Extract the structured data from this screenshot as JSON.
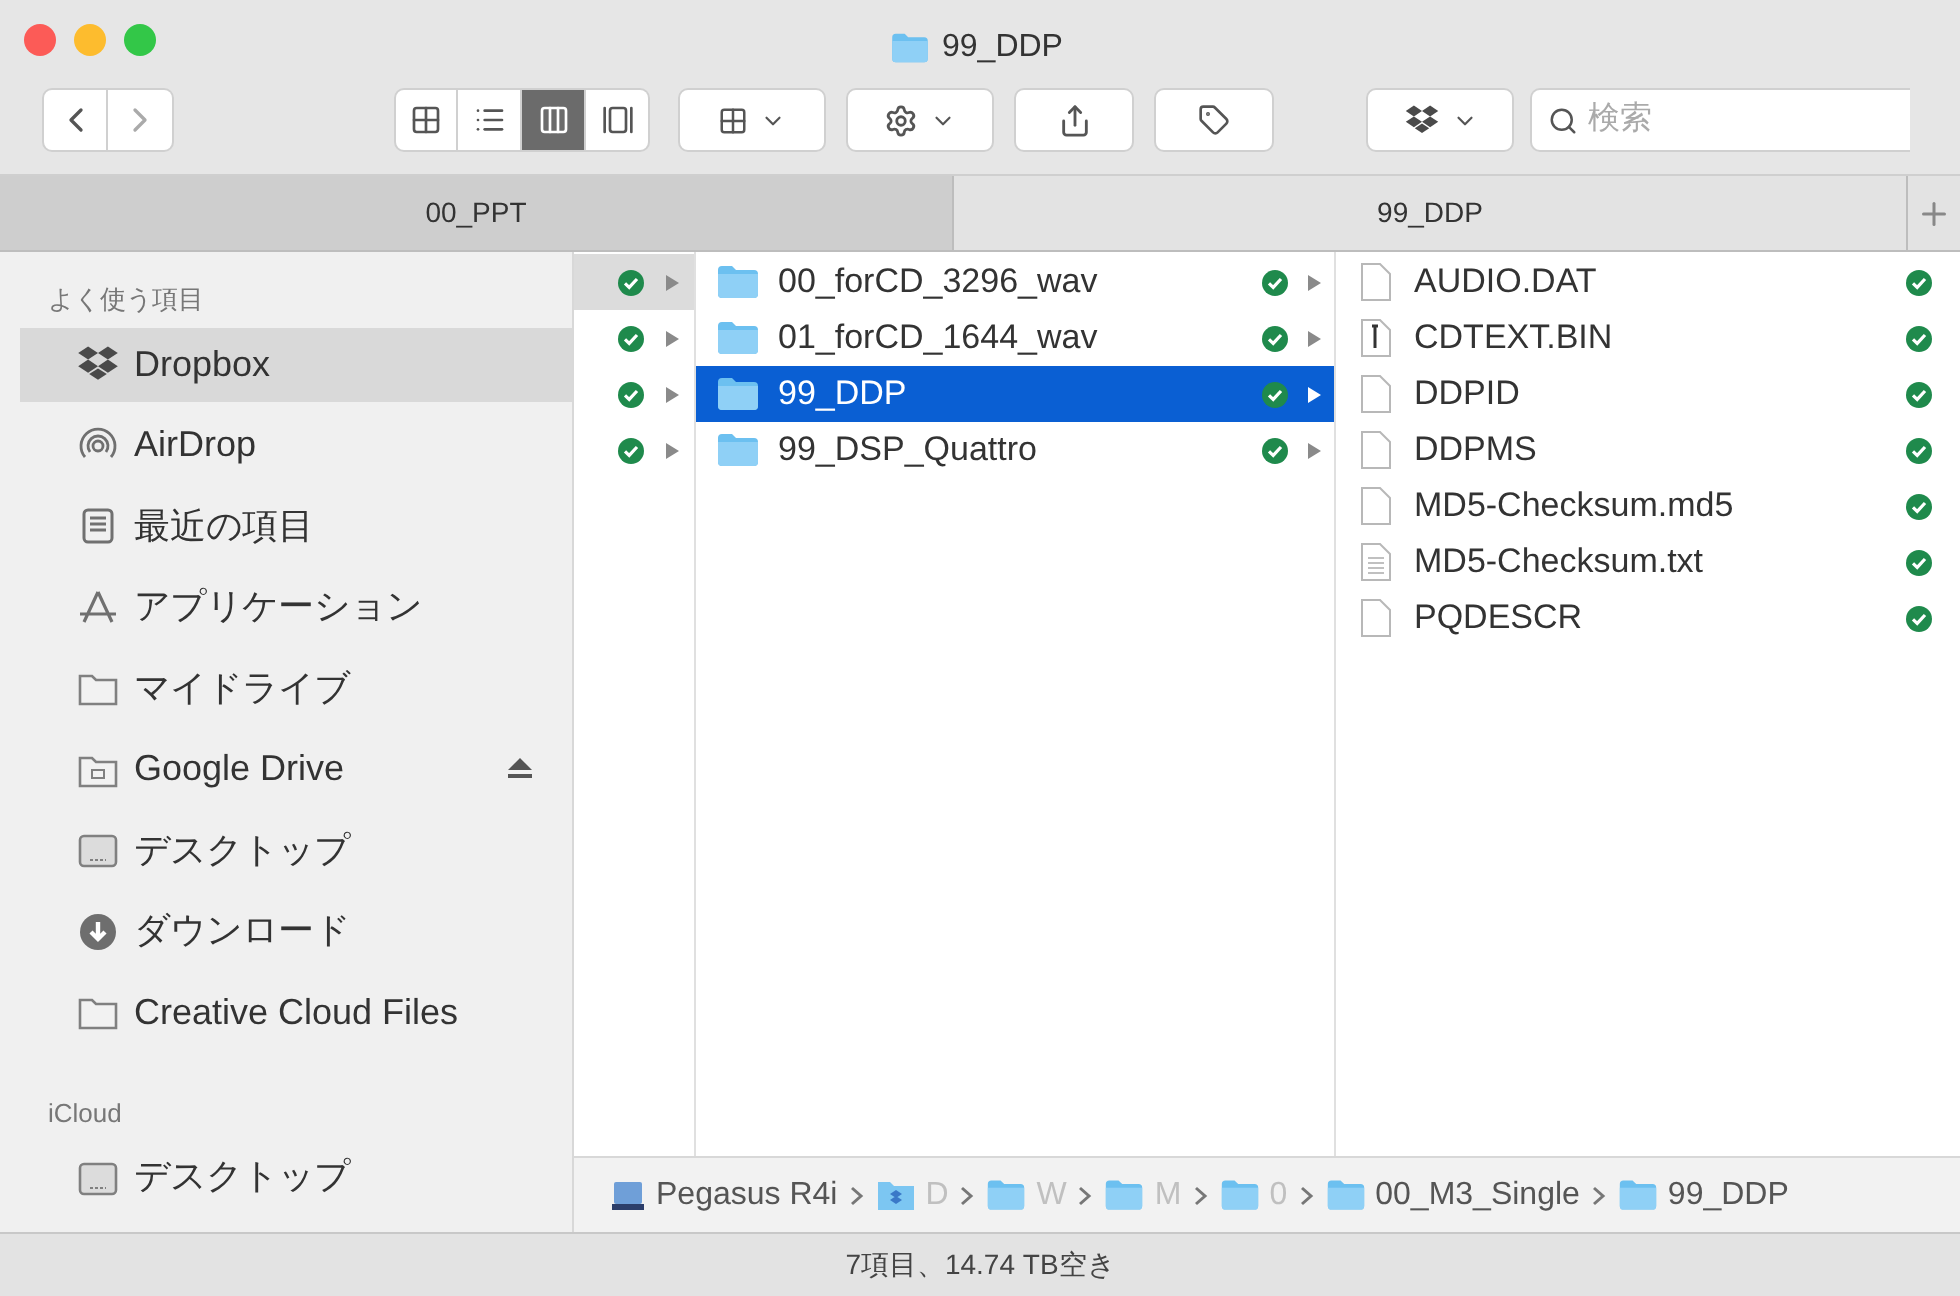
{
  "window": {
    "title": "99_DDP"
  },
  "toolbar": {
    "views": [
      {
        "kind": "icons",
        "selected": false
      },
      {
        "kind": "list",
        "selected": false
      },
      {
        "kind": "columns",
        "selected": true
      },
      {
        "kind": "gallery",
        "selected": false
      }
    ],
    "search": {
      "placeholder": "検索"
    }
  },
  "tabs": [
    {
      "label": "00_PPT",
      "selected": false
    },
    {
      "label": "99_DDP",
      "selected": true
    }
  ],
  "sidebar": {
    "sections": [
      {
        "title": "よく使う項目",
        "items": [
          {
            "label": "Dropbox",
            "kind": "dropbox",
            "selected": true
          },
          {
            "label": "AirDrop",
            "kind": "airdrop",
            "selected": false
          },
          {
            "label": "最近の項目",
            "kind": "recent",
            "selected": false
          },
          {
            "label": "アプリケーション",
            "kind": "apps",
            "selected": false
          },
          {
            "label": "マイドライブ",
            "kind": "folder",
            "selected": false
          },
          {
            "label": "Google Drive",
            "kind": "drive",
            "selected": false
          },
          {
            "label": "デスクトップ",
            "kind": "desktop",
            "selected": false
          },
          {
            "label": "ダウンロード",
            "kind": "download",
            "selected": false
          },
          {
            "label": "Creative Cloud Files",
            "kind": "folder",
            "selected": false
          }
        ]
      },
      {
        "title": "iCloud",
        "items": [
          {
            "label": "デスクトップ",
            "kind": "desktop",
            "selected": false
          }
        ]
      }
    ]
  },
  "columns": [
    {
      "rows": [
        {
          "selected": true
        },
        {
          "selected": false
        },
        {
          "selected": false
        },
        {
          "selected": false
        }
      ]
    },
    {
      "rows": [
        {
          "name": "00_forCD_3296_wav",
          "selected": false
        },
        {
          "name": "01_forCD_1644_wav",
          "selected": false
        },
        {
          "name": "99_DDP",
          "selected": true
        },
        {
          "name": "99_DSP_Quattro",
          "selected": false
        }
      ]
    },
    {
      "rows": [
        {
          "name": "AUDIO.DAT",
          "kind": "blank"
        },
        {
          "name": "CDTEXT.BIN",
          "kind": "binary"
        },
        {
          "name": "DDPID",
          "kind": "blank"
        },
        {
          "name": "DDPMS",
          "kind": "blank"
        },
        {
          "name": "MD5-Checksum.md5",
          "kind": "blank"
        },
        {
          "name": "MD5-Checksum.txt",
          "kind": "text"
        },
        {
          "name": "PQDESCR",
          "kind": "blank"
        }
      ]
    }
  ],
  "path_bar": [
    {
      "label": "Pegasus R4i",
      "kind": "disk"
    },
    {
      "label": "D",
      "kind": "dropbox"
    },
    {
      "label": "W",
      "kind": "folder"
    },
    {
      "label": "M",
      "kind": "folder"
    },
    {
      "label": "0",
      "kind": "folder"
    },
    {
      "label": "00_M3_Single",
      "kind": "folder"
    },
    {
      "label": "99_DDP",
      "kind": "folder"
    }
  ],
  "status_bar": "7項目、14.74 TB空き"
}
